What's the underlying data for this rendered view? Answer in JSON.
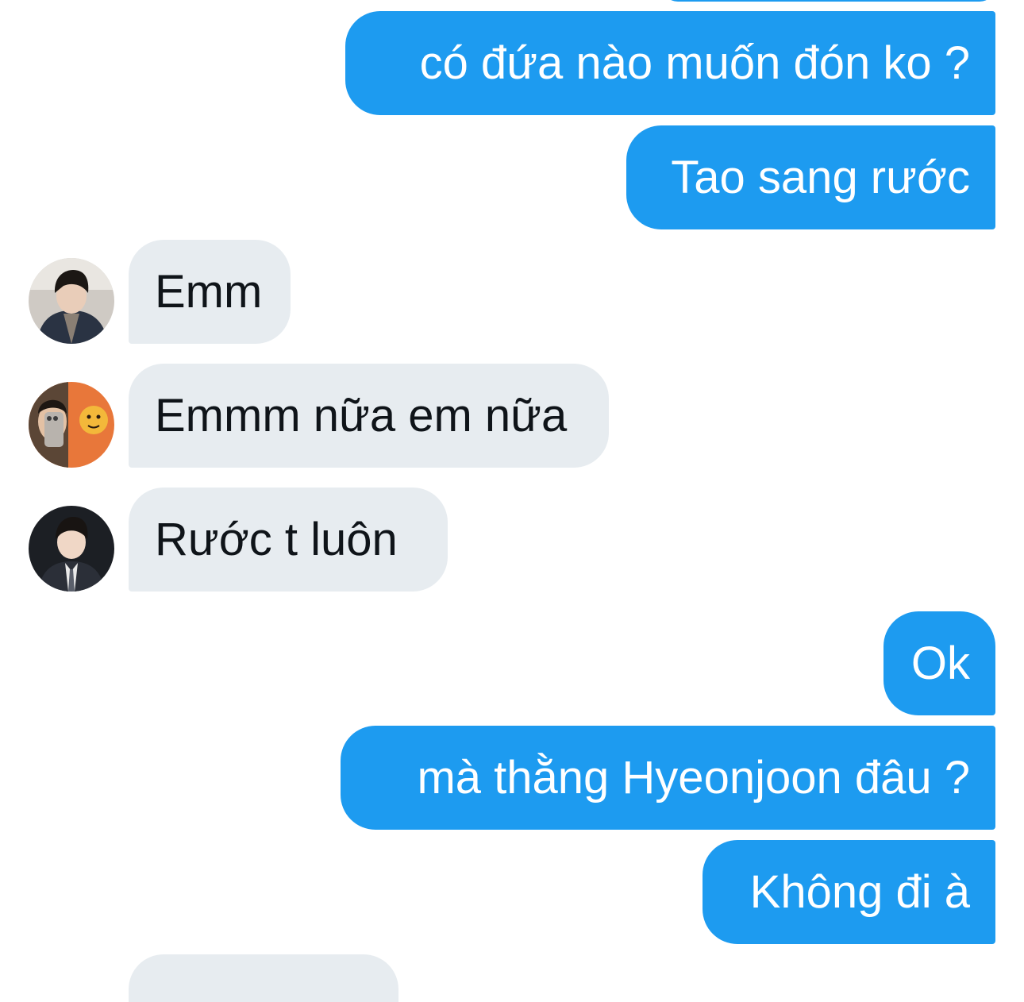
{
  "colors": {
    "outgoing_bubble": "#1d9bf0",
    "incoming_bubble": "#e7ecf0",
    "outgoing_text": "#ffffff",
    "incoming_text": "#0f1419"
  },
  "messages": [
    {
      "direction": "outgoing",
      "text": "có đứa nào muốn đón ko ?"
    },
    {
      "direction": "outgoing",
      "text": "Tao sang rước"
    },
    {
      "direction": "incoming",
      "text": "Emm",
      "avatar_icon": "user-avatar-icon"
    },
    {
      "direction": "incoming",
      "text": "Emmm nữa em nữa",
      "avatar_icon": "user-avatar-icon"
    },
    {
      "direction": "incoming",
      "text": "Rước t luôn",
      "avatar_icon": "user-avatar-icon"
    },
    {
      "direction": "outgoing",
      "text": "Ok"
    },
    {
      "direction": "outgoing",
      "text": "mà thằng Hyeonjoon đâu ?"
    },
    {
      "direction": "outgoing",
      "text": "Không đi à"
    }
  ]
}
